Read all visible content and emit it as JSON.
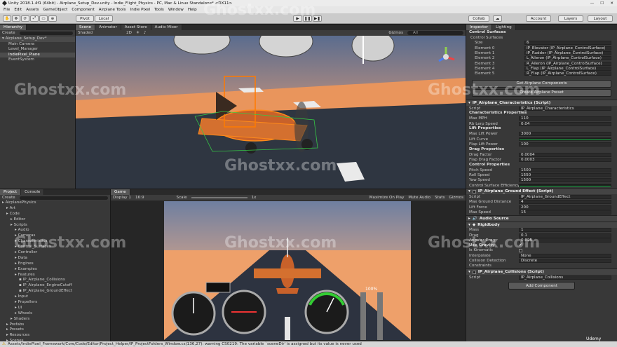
{
  "window": {
    "title": "Unity 2018.1.4f1 (64bit) - Airplane_Setup_Dev.unity - Indie_Flight_Physics - PC, Mac & Linux Standalone* <DX11>"
  },
  "menu": [
    "File",
    "Edit",
    "Assets",
    "GameObject",
    "Component",
    "Airplane Tools",
    "Indie Pixel",
    "Tools",
    "Window",
    "Help"
  ],
  "toolbar": {
    "pivot": "Pivot",
    "local": "Local",
    "collab": "Collab",
    "account": "Account",
    "layers": "Layers",
    "layout": "Layout"
  },
  "hierarchy": {
    "tab": "Hierarchy",
    "create": "Create",
    "scene": "Airplane_Setup_Dev*",
    "items": [
      "Main Camera",
      "Level_Manager",
      "IndiePixel_Plane",
      "EventSystem"
    ]
  },
  "scene": {
    "tabs": [
      "Scene",
      "Animator",
      "Asset Store",
      "Audio Mixer"
    ],
    "shading": "Shaded",
    "mode2d": "2D",
    "gizmos": "Gizmos",
    "search": "All"
  },
  "project": {
    "tabs": [
      "Project",
      "Console"
    ],
    "create": "Create",
    "items": [
      "AirplanePhysics",
      "Art",
      "Code",
      "Editor",
      "Scripts",
      "Audio",
      "Cameras",
      "Characteristics",
      "Control_Surfaces",
      "Controller",
      "Data",
      "Engines",
      "Examples",
      "Features",
      "IP_Airplane_Collisions",
      "IP_Airplane_EngineCutoff",
      "IP_Airplane_GroundEffect",
      "Input",
      "Propellers",
      "UI",
      "Wheels",
      "Shaders",
      "Prefabs",
      "Presets",
      "Resources",
      "Scenes",
      "IndiePixel_Airplanes"
    ]
  },
  "game": {
    "tab": "Game",
    "display": "Display 1",
    "aspect": "16:9",
    "scale": "Scale",
    "scale_val": "1x",
    "opts": [
      "Maximize On Play",
      "Mute Audio",
      "Stats",
      "Gizmos"
    ],
    "throttle": "100%"
  },
  "inspector": {
    "tabs": [
      "Inspector",
      "Lighting"
    ],
    "control_surfaces": {
      "title": "Control Surfaces",
      "sub": "Control Surfaces",
      "size_k": "Size",
      "size_v": "6",
      "elements": [
        [
          "Element 0",
          "IP_Elevator (IP_Airplane_ControlSurface)"
        ],
        [
          "Element 1",
          "IP_Rudder (IP_Airplane_ControlSurface)"
        ],
        [
          "Element 2",
          "L_Aileron (IP_Airplane_ControlSurface)"
        ],
        [
          "Element 3",
          "R_Aileron (IP_Airplane_ControlSurface)"
        ],
        [
          "Element 4",
          "L_Flap (IP_Airplane_ControlSurface)"
        ],
        [
          "Element 5",
          "R_Flap (IP_Airplane_ControlSurface)"
        ]
      ]
    },
    "btn_get": "Get Airplane Components",
    "btn_create": "Create Airplane Preset",
    "chars": {
      "title": "IP_Airplane_Characteristics (Script)",
      "script_k": "Script",
      "script_v": "IP_Airplane_Characteristics",
      "sec1": "Characteristics Properties",
      "maxmph_k": "Max MPH",
      "maxmph_v": "110",
      "rblerp_k": "Rb Lerp Speed",
      "rblerp_v": "0.04",
      "sec2": "Lift Properties",
      "maxlift_k": "Max Lift Power",
      "maxlift_v": "3000",
      "liftcurve_k": "Lift Curve",
      "flaplift_k": "Flap Lift Power",
      "flaplift_v": "100",
      "sec3": "Drag Properties",
      "drag_k": "Drag Factor",
      "drag_v": "0.0004",
      "flapdrag_k": "Flap Drag Factor",
      "flapdrag_v": "0.0003",
      "sec4": "Control Properties",
      "pitch_k": "Pitch Speed",
      "pitch_v": "1500",
      "roll_k": "Roll Speed",
      "roll_v": "1550",
      "yaw_k": "Yaw Speed",
      "yaw_v": "1500",
      "eff_k": "Control Surface Efficiency"
    },
    "ground": {
      "title": "IP_Airplane_Ground Effect (Script)",
      "script_k": "Script",
      "script_v": "IP_Airplane_GroundEffect",
      "maxdist_k": "Max Ground Distance",
      "maxdist_v": "4",
      "lift_k": "Lift Force",
      "lift_v": "200",
      "maxspd_k": "Max Speed",
      "maxspd_v": "15"
    },
    "audio": "Audio Source",
    "rb": {
      "title": "Rigidbody",
      "mass_k": "Mass",
      "mass_v": "1",
      "drag_k": "Drag",
      "drag_v": "0.1",
      "adrag_k": "Angular Drag",
      "adrag_v": "0.025",
      "grav_k": "Use Gravity",
      "kin_k": "Is Kinematic",
      "interp_k": "Interpolate",
      "interp_v": "None",
      "coll_k": "Collision Detection",
      "coll_v": "Discrete",
      "cons_k": "Constraints"
    },
    "collisions": {
      "title": "IP_Airplane_Collisions (Script)",
      "script_k": "Script",
      "script_v": "IP_Airplane_Collisions"
    },
    "add": "Add Component"
  },
  "status": "Assets/IndiePixel_Framework/Core/Code/Editor/Project_Helper/IP_ProjectFolders_Window.cs(136,27): warning CS0219: The variable `sceneDir' is assigned but its value is never used",
  "watermark": "Ghostxx.com",
  "udemy": "Udemy"
}
